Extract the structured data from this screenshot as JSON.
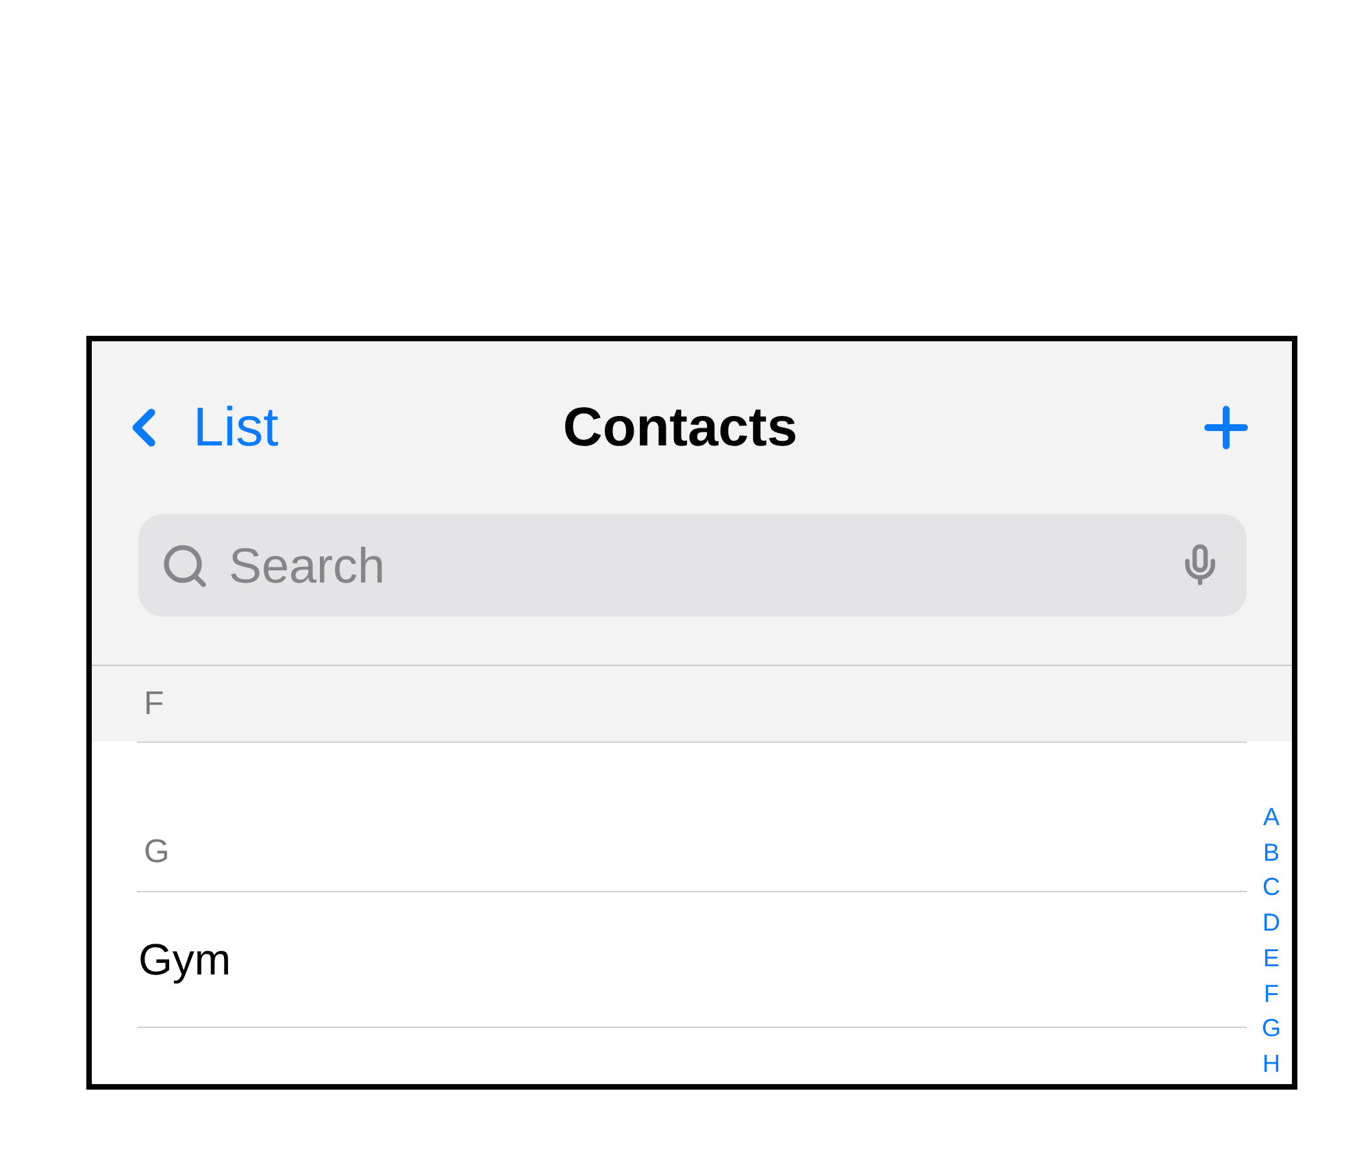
{
  "nav": {
    "back_label": "List",
    "title": "Contacts"
  },
  "search": {
    "placeholder": "Search"
  },
  "sections": [
    {
      "letter": "F",
      "kind": "sticky"
    },
    {
      "letter": "G",
      "kind": "plain",
      "rows": [
        "Gym"
      ]
    }
  ],
  "index": [
    "A",
    "B",
    "C",
    "D",
    "E",
    "F",
    "G",
    "H"
  ]
}
